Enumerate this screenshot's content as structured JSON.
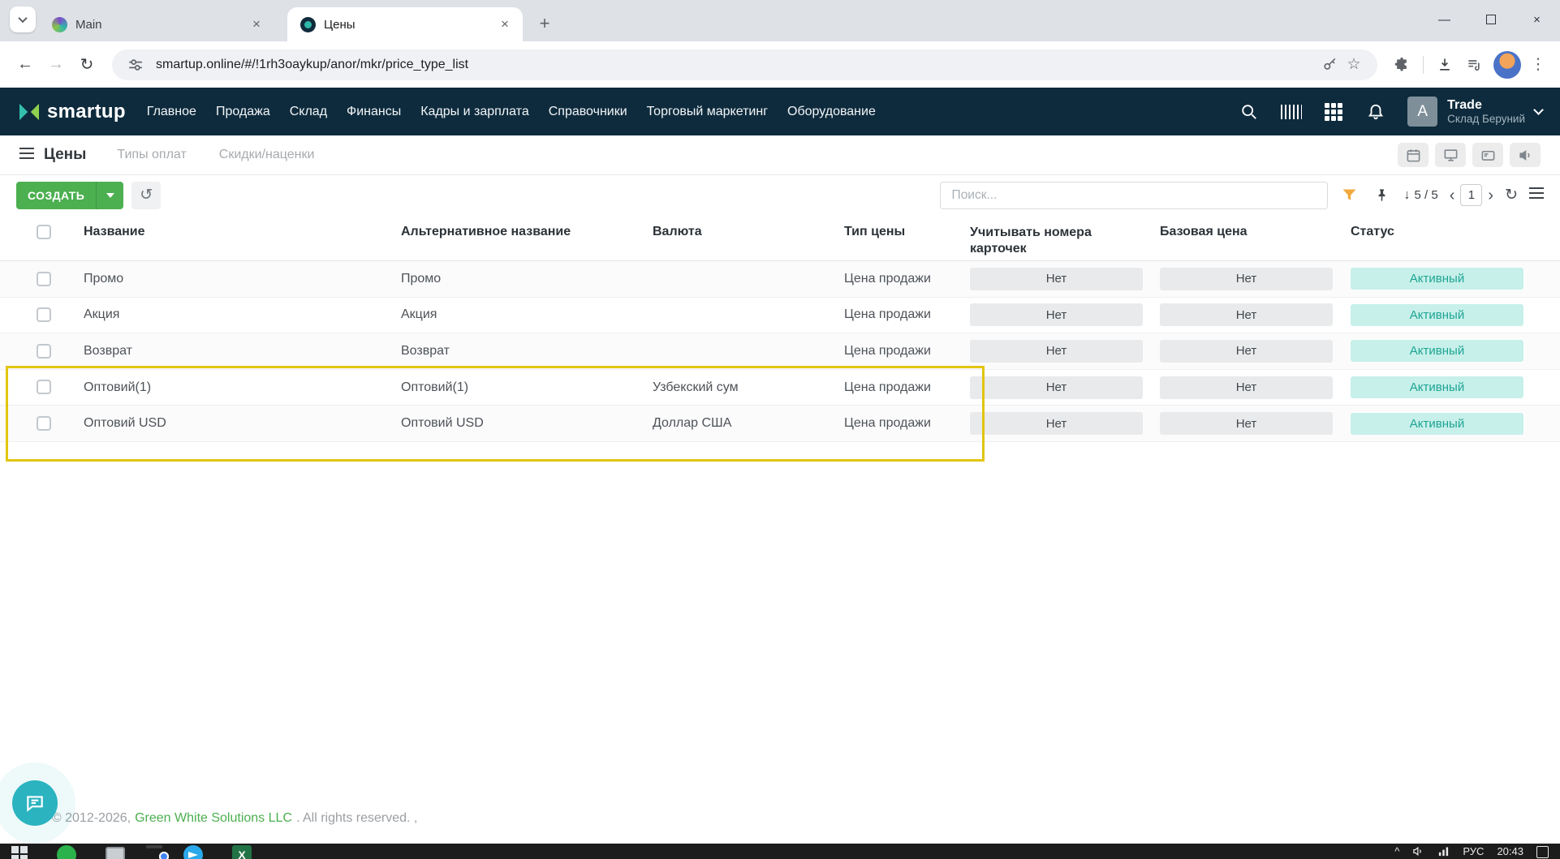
{
  "browser": {
    "tabs": [
      {
        "title": "Main"
      },
      {
        "title": "Цены"
      }
    ],
    "url": "smartup.online/#/!1rh3oaykup/anor/mkr/price_type_list"
  },
  "glyphs": {
    "close": "×",
    "minimize": "—",
    "plus": "+",
    "back": "←",
    "forward": "→",
    "reload": "↻",
    "star": "☆",
    "kebab": "⋮",
    "history": "↺",
    "download": "↓",
    "prev": "‹",
    "next": "›",
    "refresh": "↻",
    "tray_up": "^"
  },
  "header": {
    "brand": "smartup",
    "nav": [
      {
        "label": "Главное"
      },
      {
        "label": "Продажа"
      },
      {
        "label": "Склад"
      },
      {
        "label": "Финансы"
      },
      {
        "label": "Кадры и зарплата"
      },
      {
        "label": "Справочники"
      },
      {
        "label": "Торговый маркетинг"
      },
      {
        "label": "Оборудование"
      }
    ],
    "user": {
      "avatar_initial": "A",
      "company": "Trade",
      "branch": "Склад Беруний"
    }
  },
  "page": {
    "title": "Цены",
    "tabs": [
      {
        "label": "Типы оплат"
      },
      {
        "label": "Скидки/наценки"
      }
    ],
    "toolbar": {
      "create_label": "СОЗДАТЬ",
      "search_placeholder": "Поиск...",
      "counter": "5 / 5",
      "page_number": "1"
    }
  },
  "table": {
    "headers": {
      "name": "Название",
      "alt_name": "Альтернативное название",
      "currency": "Валюта",
      "price_type": "Тип цены",
      "card_numbers": "Учитывать номера карточек",
      "base_price": "Базовая цена",
      "status": "Статус"
    },
    "rows": [
      {
        "name": "Промо",
        "alt_name": "Промо",
        "currency": "",
        "price_type": "Цена продажи",
        "card_numbers": "Нет",
        "base_price": "Нет",
        "status": "Активный"
      },
      {
        "name": "Акция",
        "alt_name": "Акция",
        "currency": "",
        "price_type": "Цена продажи",
        "card_numbers": "Нет",
        "base_price": "Нет",
        "status": "Активный"
      },
      {
        "name": "Возврат",
        "alt_name": "Возврат",
        "currency": "",
        "price_type": "Цена продажи",
        "card_numbers": "Нет",
        "base_price": "Нет",
        "status": "Активный"
      },
      {
        "name": "Оптовий(1)",
        "alt_name": "Оптовий(1)",
        "currency": "Узбекский сум",
        "price_type": "Цена продажи",
        "card_numbers": "Нет",
        "base_price": "Нет",
        "status": "Активный"
      },
      {
        "name": "Оптовий USD",
        "alt_name": "Оптовий USD",
        "currency": "Доллар США",
        "price_type": "Цена продажи",
        "card_numbers": "Нет",
        "base_price": "Нет",
        "status": "Активный"
      }
    ]
  },
  "footer": {
    "copyright_prefix": "t © 2012-2026,",
    "company_link": "Green White Solutions LLC",
    "copyright_suffix": ". All rights reserved. ,"
  },
  "taskbar": {
    "language": "РУС",
    "time": "20:43"
  },
  "colors": {
    "header_navy": "#0e2b3d",
    "accent_green": "#4caf50",
    "status_active_bg": "#c7f0ea",
    "status_active_text": "#1ea493",
    "badge_gray_bg": "#e9eaeb",
    "highlight_yellow": "#e2c50f",
    "chat_teal": "#2bb3c0"
  }
}
